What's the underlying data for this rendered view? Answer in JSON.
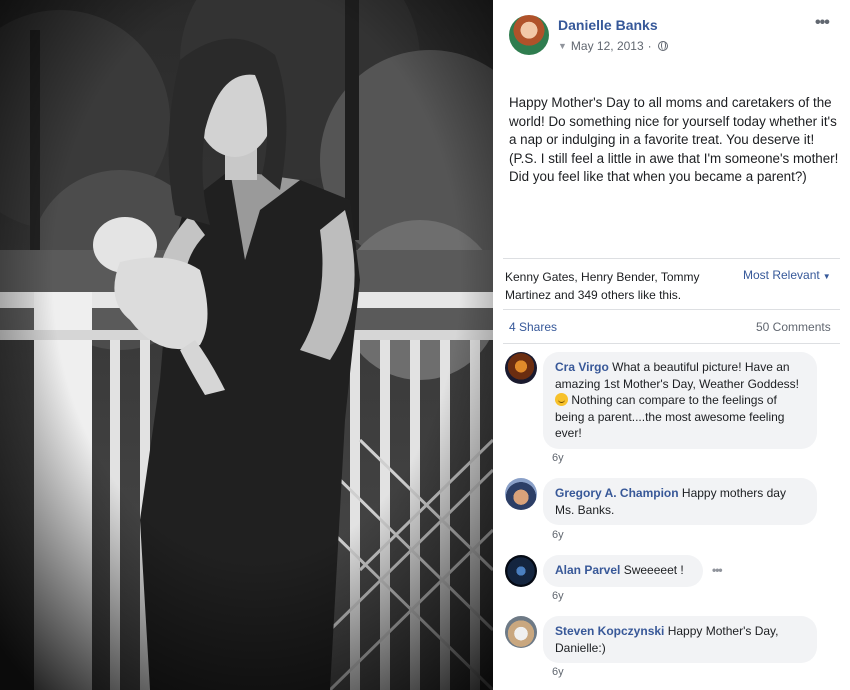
{
  "post": {
    "author": "Danielle Banks",
    "date": "May 12, 2013",
    "text": "Happy Mother's Day to all moms and caretakers of the world! Do something nice for yourself today whether it's a nap or indulging in a favorite treat. You deserve it! (P.S. I still feel a little in awe that I'm someone's mother! Did you feel like that when you became a parent?)"
  },
  "icons": {
    "options": "more-horizontal-icon",
    "privacy": "globe-icon",
    "date_caret": "caret-down-icon"
  },
  "reactions": {
    "likes_text": "Kenny Gates, Henry Bender, Tommy Martinez and 349 others like this.",
    "sort_label": "Most Relevant",
    "shares": "4 Shares",
    "comments_count": "50 Comments"
  },
  "comments": [
    {
      "name": "Cra Virgo",
      "text_before_emoji": " What a beautiful picture! Have an amazing 1st Mother's Day, Weather Goddess! ",
      "text_after_emoji": " Nothing can compare to the feelings of being a parent....the most awesome feeling ever!",
      "age": "6y"
    },
    {
      "name": "Gregory A. Champion",
      "text": " Happy mothers day Ms. Banks.",
      "age": "6y"
    },
    {
      "name": "Alan Parvel",
      "text": " Sweeeeet !",
      "age": "6y"
    },
    {
      "name": "Steven Kopczynski",
      "text": " Happy Mother's Day, Danielle:)",
      "age": "6y"
    }
  ],
  "colors": {
    "link": "#365899",
    "bubble": "#f2f3f5",
    "meta": "#616770"
  }
}
